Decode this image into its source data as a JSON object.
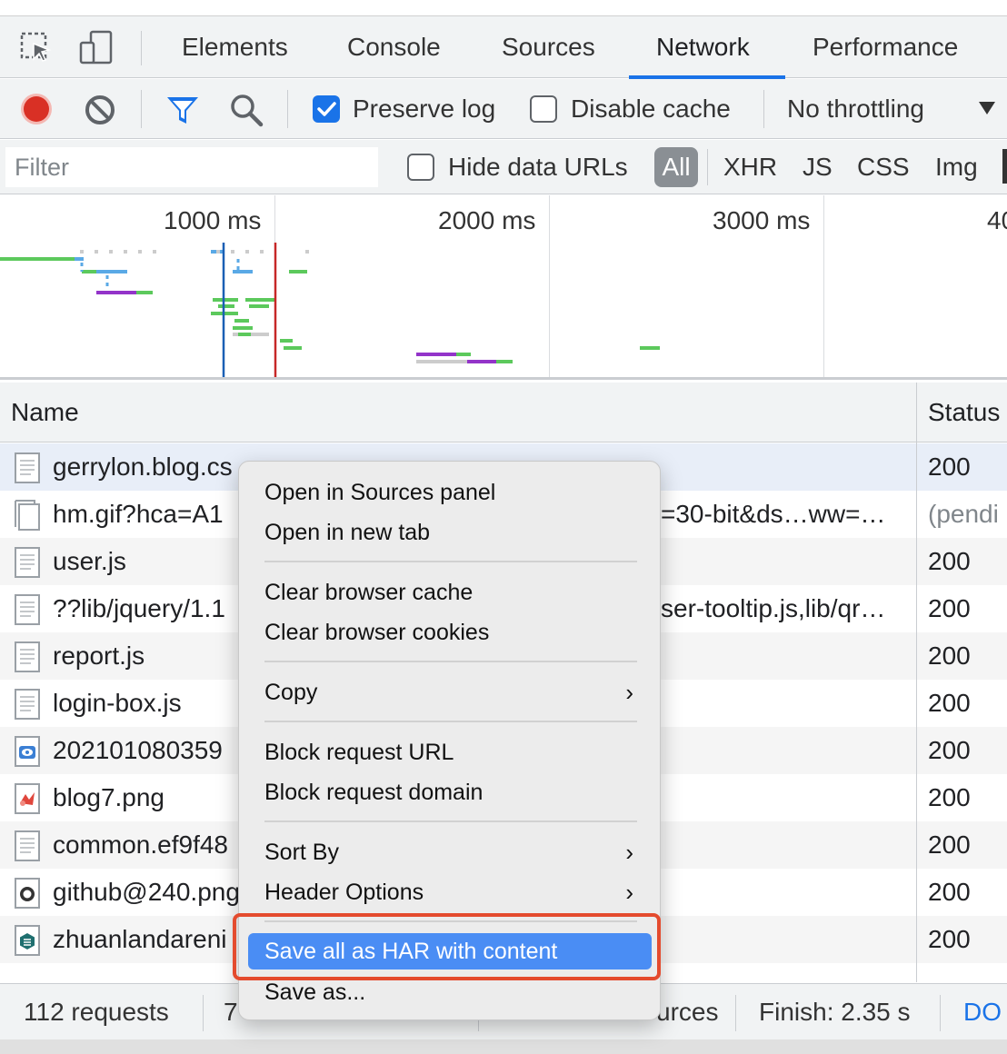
{
  "tabs": [
    {
      "label": "Elements",
      "active": false
    },
    {
      "label": "Console",
      "active": false
    },
    {
      "label": "Sources",
      "active": false
    },
    {
      "label": "Network",
      "active": true
    },
    {
      "label": "Performance",
      "active": false
    }
  ],
  "toolbar": {
    "preserve_log": {
      "label": "Preserve log",
      "checked": true
    },
    "disable_cache": {
      "label": "Disable cache",
      "checked": false
    },
    "throttling": "No throttling"
  },
  "filterbar": {
    "placeholder": "Filter",
    "hide_data_urls": {
      "label": "Hide data URLs",
      "checked": false
    },
    "types": [
      "All",
      "XHR",
      "JS",
      "CSS",
      "Img"
    ]
  },
  "overview": {
    "ticks": [
      "1000 ms",
      "2000 ms",
      "3000 ms",
      "40"
    ]
  },
  "table": {
    "columns": [
      "Name",
      "Status"
    ],
    "rows": [
      {
        "name": "gerrylon.blog.cs",
        "extra": "",
        "status": "200",
        "icon": "document-icon"
      },
      {
        "name": "hm.gif?hca=A1",
        "extra": "=30-bit&ds…ww=…",
        "status": "(pendi",
        "icon": "blank-file-icon"
      },
      {
        "name": "user.js",
        "extra": "",
        "status": "200",
        "icon": "script-file-icon"
      },
      {
        "name": "??lib/jquery/1.1",
        "extra": "ser-tooltip.js,lib/qr…",
        "status": "200",
        "icon": "script-file-icon"
      },
      {
        "name": "report.js",
        "extra": "",
        "status": "200",
        "icon": "script-file-icon"
      },
      {
        "name": "login-box.js",
        "extra": "",
        "status": "200",
        "icon": "script-file-icon"
      },
      {
        "name": "202101080359",
        "extra": "",
        "status": "200",
        "icon": "image-file-icon"
      },
      {
        "name": "blog7.png",
        "extra": "",
        "status": "200",
        "icon": "image-file-icon"
      },
      {
        "name": "common.ef9f48",
        "extra": "",
        "status": "200",
        "icon": "stylesheet-file-icon"
      },
      {
        "name": "github@240.png",
        "extra": "",
        "status": "200",
        "icon": "image-file-icon"
      },
      {
        "name": "zhuanlandareni",
        "extra": "",
        "status": "200",
        "icon": "image-file-icon"
      }
    ]
  },
  "statusbar": {
    "requests": "112 requests",
    "transferred_partial": "7",
    "resources_partial": "urces",
    "finish": "Finish: 2.35 s",
    "dom": "DO"
  },
  "context_menu": {
    "items": [
      {
        "label": "Open in Sources panel",
        "submenu": false
      },
      {
        "label": "Open in new tab",
        "submenu": false
      },
      {
        "label": "Clear browser cache",
        "submenu": false
      },
      {
        "label": "Clear browser cookies",
        "submenu": false
      },
      {
        "label": "Copy",
        "submenu": true
      },
      {
        "label": "Block request URL",
        "submenu": false
      },
      {
        "label": "Block request domain",
        "submenu": false
      },
      {
        "label": "Sort By",
        "submenu": true
      },
      {
        "label": "Header Options",
        "submenu": true
      },
      {
        "label": "Save all as HAR with content",
        "submenu": false,
        "highlighted": true
      },
      {
        "label": "Save as...",
        "submenu": false
      }
    ],
    "chevron": "›"
  },
  "colors": {
    "accent": "#1a73e8",
    "record": "#d93025",
    "menu_highlight": "#4a8df4",
    "annotation": "#e44b2e",
    "waterfall_green": "#5cc95c",
    "waterfall_blue": "#5aa9e6",
    "waterfall_purple": "#9334c9",
    "dom_line": "#1a5fb4",
    "load_line": "#c62828"
  }
}
